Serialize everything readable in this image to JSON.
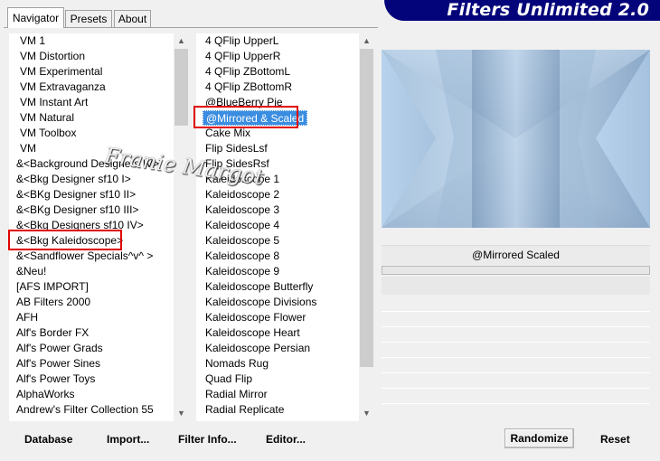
{
  "tabs": [
    {
      "label": "Navigator",
      "active": true
    },
    {
      "label": "Presets",
      "active": false
    },
    {
      "label": "About",
      "active": false
    }
  ],
  "banner": {
    "title": "Filters Unlimited 2.0",
    "color": "#04047a"
  },
  "categories": {
    "items": [
      "VM 1",
      "VM Distortion",
      "VM Experimental",
      "VM Extravaganza",
      "VM Instant Art",
      "VM Natural",
      "VM Toolbox",
      "VM",
      "&<Background Designers IV>",
      "&<Bkg Designer sf10 I>",
      "&<BKg Designer sf10 II>",
      "&<BKg Designer sf10 III>",
      "&<Bkg Designers sf10 IV>",
      "&<Bkg Kaleidoscope>",
      "&<Sandflower Specials^v^ >",
      "&Neu!",
      "[AFS IMPORT]",
      "AB Filters 2000",
      "AFH",
      "Alf's Border FX",
      "Alf's Power Grads",
      "Alf's Power Sines",
      "Alf's Power Toys",
      "AlphaWorks",
      "Andrew's Filter Collection 55"
    ],
    "highlighted_index": 13
  },
  "filters": {
    "items": [
      "4 QFlip UpperL",
      "4 QFlip UpperR",
      "4 QFlip ZBottomL",
      "4 QFlip ZBottomR",
      "@BlueBerry Pie",
      "@Mirrored & Scaled",
      "Cake Mix",
      "Flip SidesLsf",
      "Flip SidesRsf",
      "Kaleidoscope 1",
      "Kaleidoscope 2",
      "Kaleidoscope 3",
      "Kaleidoscope 4",
      "Kaleidoscope 5",
      "Kaleidoscope 8",
      "Kaleidoscope 9",
      "Kaleidoscope Butterfly",
      "Kaleidoscope Divisions",
      "Kaleidoscope Flower",
      "Kaleidoscope Heart",
      "Kaleidoscope Persian",
      "Nomads Rug",
      "Quad Flip",
      "Radial Mirror",
      "Radial Replicate"
    ],
    "selected_index": 5
  },
  "preview": {
    "filter_name": "@Mirrored  Scaled"
  },
  "buttons": {
    "database": "Database",
    "import": "Import...",
    "filter_info": "Filter Info...",
    "editor": "Editor...",
    "randomize": "Randomize",
    "reset": "Reset"
  },
  "icons": {
    "scroll_up": "chevron-up-icon",
    "scroll_down": "chevron-down-icon"
  },
  "colors": {
    "selection": "#3a8de0",
    "highlight_box": "#e00000"
  }
}
